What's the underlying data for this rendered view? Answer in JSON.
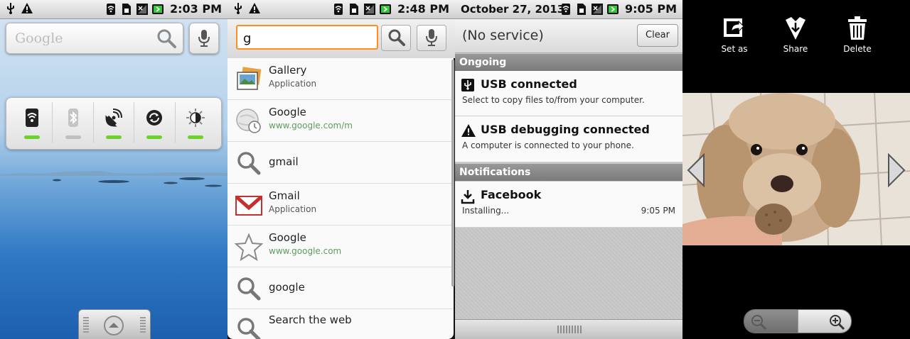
{
  "screens": {
    "home": {
      "status_time": "2:03 PM",
      "search_placeholder": "Google",
      "power_controls": [
        {
          "icon": "wifi-icon",
          "state": "on"
        },
        {
          "icon": "bluetooth-icon",
          "state": "off"
        },
        {
          "icon": "gps-icon",
          "state": "on"
        },
        {
          "icon": "sync-icon",
          "state": "on"
        },
        {
          "icon": "brightness-icon",
          "state": "on"
        }
      ]
    },
    "search": {
      "status_time": "2:48 PM",
      "query": "g",
      "suggestions": [
        {
          "icon": "gallery-icon",
          "title": "Gallery",
          "subtitle": "Application",
          "subtitle_type": "text"
        },
        {
          "icon": "history-icon",
          "title": "Google",
          "subtitle": "www.google.com/m",
          "subtitle_type": "url"
        },
        {
          "icon": "search-icon",
          "title": "gmail",
          "subtitle": "",
          "subtitle_type": "none"
        },
        {
          "icon": "gmail-icon",
          "title": "Gmail",
          "subtitle": "Application",
          "subtitle_type": "text"
        },
        {
          "icon": "star-icon",
          "title": "Google",
          "subtitle": "www.google.com",
          "subtitle_type": "url"
        },
        {
          "icon": "search-icon",
          "title": "google",
          "subtitle": "",
          "subtitle_type": "none"
        },
        {
          "icon": "search-icon",
          "title": "Search the web",
          "subtitle": "",
          "subtitle_type": "none"
        }
      ]
    },
    "notifications": {
      "status_date": "October 27, 2013",
      "status_time": "9:05 PM",
      "carrier": "(No service)",
      "clear_label": "Clear",
      "ongoing_header": "Ongoing",
      "ongoing": [
        {
          "icon": "usb-icon",
          "title": "USB connected",
          "text": "Select to copy files to/from your computer."
        },
        {
          "icon": "warning-icon",
          "title": "USB debugging connected",
          "text": "A computer is connected to your phone."
        }
      ],
      "notifications_header": "Notifications",
      "notifications": [
        {
          "icon": "download-icon",
          "title": "Facebook",
          "text": "Installing...",
          "time": "9:05 PM"
        }
      ]
    },
    "gallery": {
      "actions": [
        {
          "icon": "set-as-icon",
          "label": "Set as"
        },
        {
          "icon": "share-icon",
          "label": "Share"
        },
        {
          "icon": "delete-icon",
          "label": "Delete"
        }
      ],
      "zoom": {
        "out_icon": "zoom-out-icon",
        "in_icon": "zoom-in-icon"
      }
    }
  }
}
